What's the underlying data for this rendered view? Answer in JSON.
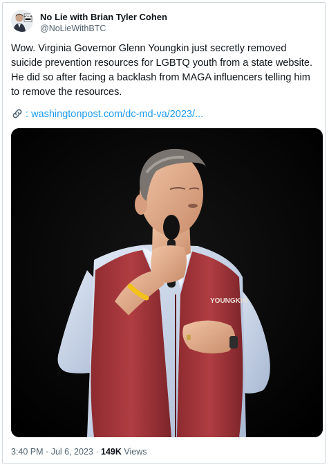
{
  "author": {
    "name": "No Lie with Brian Tyler Cohen",
    "handle": "@NoLieWithBTC",
    "avatar_badge": "NO LIE"
  },
  "tweet": {
    "text": "Wow. Virginia Governor Glenn Youngkin just secretly removed suicide prevention resources for LGBTQ youth from a state website. He did so after facing a backlash from MAGA influencers telling him to remove the resources.",
    "link_icon": "link-icon",
    "link_prefix": ":",
    "link_text": "washingtonpost.com/dc-md-va/2023/..."
  },
  "media": {
    "vest_text": "YOUNGKIN"
  },
  "meta": {
    "time": "3:40 PM",
    "separator": "·",
    "date": "Jul 6, 2023",
    "views_count": "149K",
    "views_label": "Views"
  },
  "colors": {
    "link": "#1d9bf0",
    "secondary_text": "#536471",
    "border": "#cfd9de",
    "vest_red": "#a8353a"
  }
}
